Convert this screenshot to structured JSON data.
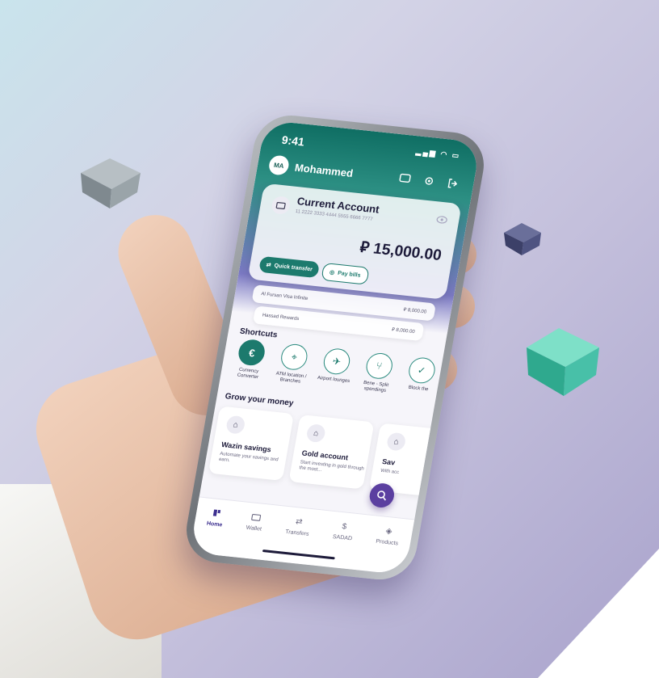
{
  "status": {
    "time": "9:41"
  },
  "user": {
    "initials": "MA",
    "name": "Mohammed"
  },
  "account": {
    "title": "Current Account",
    "number": "11 2222 3333 4444 5555 6666 7777",
    "balance": "⃁ 15,000.00",
    "quick_transfer": "Quick transfer",
    "pay_bills": "Pay bills"
  },
  "sub_accounts": [
    {
      "name": "Al Fursan Visa Infinite",
      "amount": "⃁ 8,000.00"
    },
    {
      "name": "Hassad Rewards",
      "amount": "⃁ 8,000.00"
    }
  ],
  "shortcuts": {
    "title": "Shortcuts",
    "items": [
      {
        "label": "Currency Converter",
        "icon": "currency-icon"
      },
      {
        "label": "ATM location / Branches",
        "icon": "location-icon"
      },
      {
        "label": "Airport lounges",
        "icon": "airplane-icon"
      },
      {
        "label": "Bene - Split spendings",
        "icon": "split-icon"
      },
      {
        "label": "Block the",
        "icon": "shield-icon"
      }
    ]
  },
  "grow": {
    "title": "Grow your money",
    "items": [
      {
        "title": "Wazin savings",
        "desc": "Automate your savings and earn."
      },
      {
        "title": "Gold account",
        "desc": "Start investing in gold through the most..."
      },
      {
        "title": "Sav",
        "desc": "With acc"
      }
    ]
  },
  "tabs": [
    {
      "label": "Home",
      "icon": "home-icon"
    },
    {
      "label": "Wallet",
      "icon": "wallet-icon"
    },
    {
      "label": "Transfers",
      "icon": "transfer-icon"
    },
    {
      "label": "SADAD",
      "icon": "sadad-icon"
    },
    {
      "label": "Products",
      "icon": "products-icon"
    }
  ],
  "colors": {
    "brand": "#1c7a6d",
    "accent": "#5b3fa0",
    "cube_teal": "#48c0a8",
    "cube_gray": "#8c969c",
    "cube_navy": "#4a4f7a"
  }
}
